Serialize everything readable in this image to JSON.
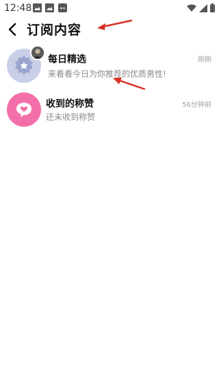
{
  "status_bar": {
    "time": "12:48",
    "left_icons": [
      "image-icon",
      "image-icon",
      "app-icon"
    ],
    "right_icons": [
      "wifi-icon",
      "signal-icon",
      "battery-icon"
    ]
  },
  "header": {
    "title": "订阅内容"
  },
  "list": [
    {
      "title": "每日精选",
      "subtitle": "来看看今日为你推荐的优质男性!",
      "time": "刚刚",
      "icon": "star-badge-icon",
      "icon_bg": "#c9cfe6",
      "has_user_avatar": true
    },
    {
      "title": "收到的称赞",
      "subtitle": "还未收到称赞",
      "time": "56分钟前",
      "icon": "heart-chat-icon",
      "icon_bg": "#f36fa9",
      "has_user_avatar": false
    }
  ],
  "colors": {
    "annotation_arrow": "#d93025",
    "accent_pink": "#f36fa9"
  }
}
